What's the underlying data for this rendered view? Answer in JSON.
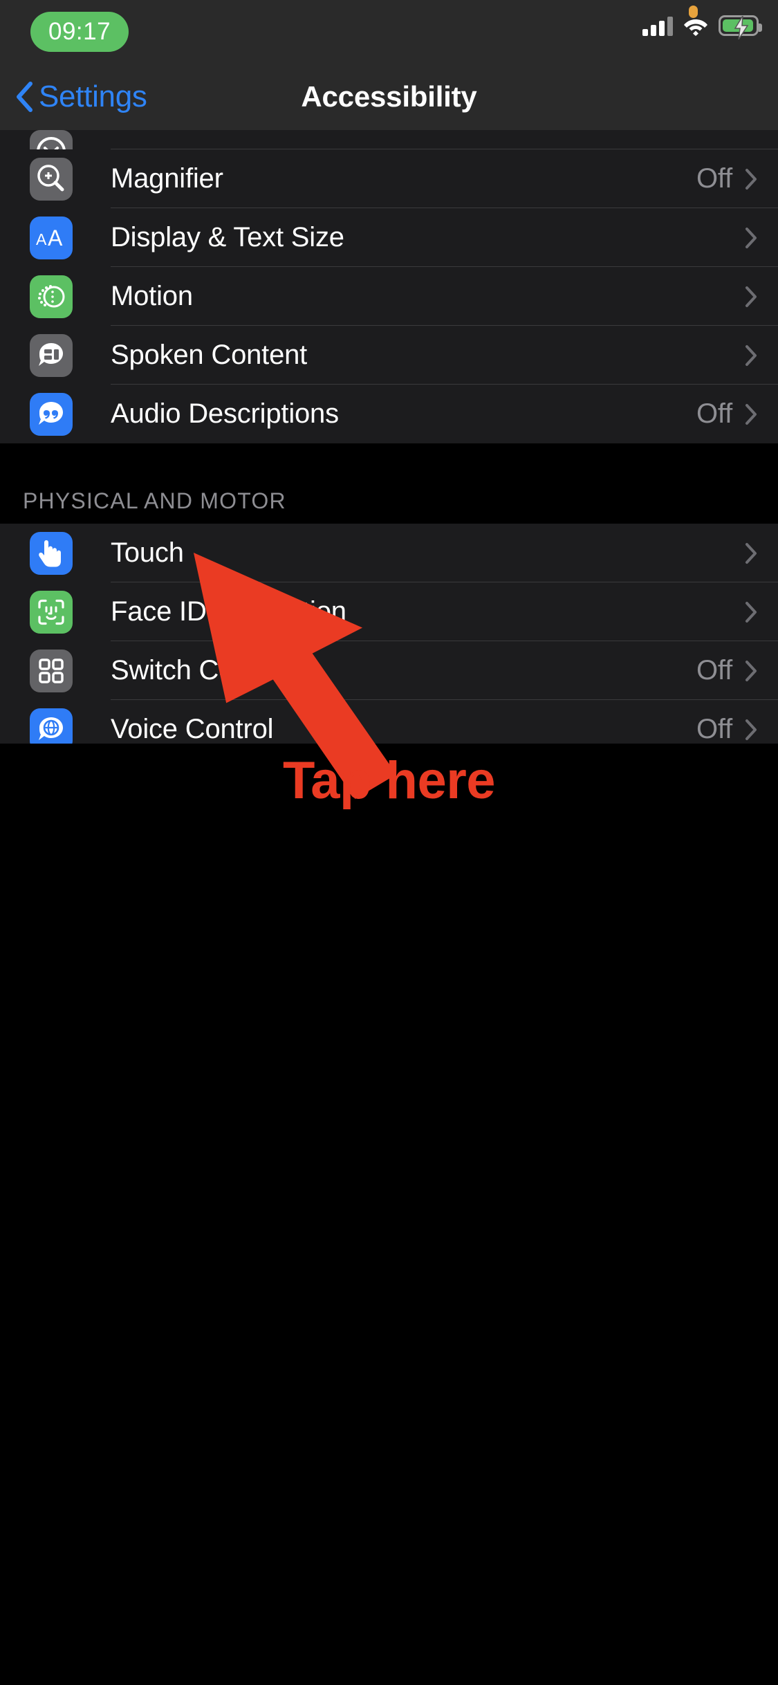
{
  "status_bar": {
    "time": "09:17",
    "time_pill_color": "#5cc063",
    "privacy_indicator": "orange-dot",
    "signal_bars_filled": 3,
    "signal_bars_total": 4,
    "wifi": "wifi-icon",
    "battery": "charging",
    "battery_color": "#5cc063"
  },
  "nav_bar": {
    "back_label": "Settings",
    "back_color": "#2f84f6",
    "title": "Accessibility"
  },
  "sections": [
    {
      "header": "",
      "rows": [
        {
          "label": "",
          "value": "",
          "icon": "partial-cut-icon",
          "icon_color": "#636366",
          "partial": true
        },
        {
          "label": "Magnifier",
          "value": "Off",
          "icon": "magnifier-icon",
          "icon_color": "#636366"
        },
        {
          "label": "Display & Text Size",
          "value": "",
          "icon": "aa-text-size-icon",
          "icon_color": "#2f7cf6"
        },
        {
          "label": "Motion",
          "value": "",
          "icon": "motion-icon",
          "icon_color": "#5cc063"
        },
        {
          "label": "Spoken Content",
          "value": "",
          "icon": "spoken-content-icon",
          "icon_color": "#636366"
        },
        {
          "label": "Audio Descriptions",
          "value": "Off",
          "icon": "audio-descriptions-icon",
          "icon_color": "#2f7cf6"
        }
      ]
    },
    {
      "header": "PHYSICAL AND MOTOR",
      "rows": [
        {
          "label": "Touch",
          "value": "",
          "icon": "touch-hand-icon",
          "icon_color": "#2f7cf6"
        },
        {
          "label": "Face ID & Attention",
          "value": "",
          "icon": "face-id-icon",
          "icon_color": "#5cc063"
        },
        {
          "label": "Switch Control",
          "value": "Off",
          "icon": "switch-control-grid-icon",
          "icon_color": "#636366"
        },
        {
          "label": "Voice Control",
          "value": "Off",
          "icon": "voice-control-icon",
          "icon_color": "#2f7cf6"
        }
      ]
    }
  ],
  "annotation": {
    "arrow": "red-arrow-pointing-up-left",
    "arrow_color": "#ea3b23",
    "caption": "Tap here",
    "caption_color": "#ea3b23"
  }
}
